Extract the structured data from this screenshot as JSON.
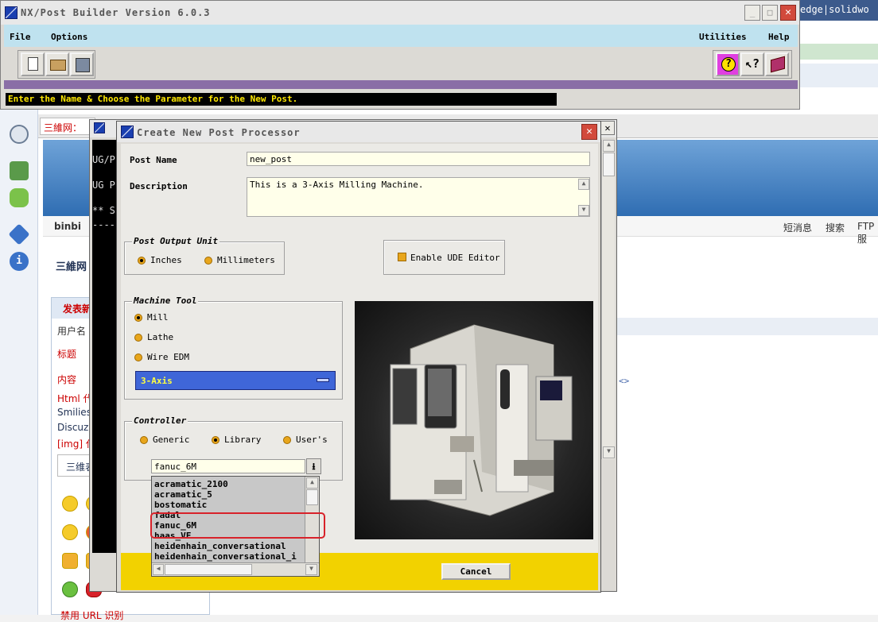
{
  "nx_window": {
    "title": "NX/Post Builder Version 6.0.3",
    "menus": {
      "file": "File",
      "options": "Options",
      "utilities": "Utilities",
      "help": "Help"
    },
    "toolbar": [
      "new-file-icon",
      "open-file-icon",
      "save-icon"
    ],
    "help_tools": [
      "help-question-icon",
      "context-help-icon",
      "manual-book-icon"
    ],
    "status_message": "Enter the Name & Choose the Parameter for the New Post."
  },
  "console": {
    "lines": [
      "UG/P",
      "UG P",
      "** S",
      "----"
    ]
  },
  "dialog": {
    "title": "Create New Post Processor",
    "post_name_label": "Post Name",
    "post_name_value": "new_post",
    "description_label": "Description",
    "description_value": "This is a 3-Axis Milling Machine.",
    "output_unit": {
      "title": "Post Output Unit",
      "options": [
        "Inches",
        "Millimeters"
      ],
      "selected": "Inches"
    },
    "ude_editor_label": "Enable UDE Editor",
    "machine_tool": {
      "title": "Machine Tool",
      "options": [
        "Mill",
        "Lathe",
        "Wire EDM"
      ],
      "selected": "Mill",
      "axis_value": "3-Axis"
    },
    "controller": {
      "title": "Controller",
      "options": [
        "Generic",
        "Library",
        "User's"
      ],
      "selected": "Library",
      "combo_value": "fanuc_6M",
      "list_items": [
        "acramatic_2100",
        "acramatic_5",
        "bostomatic",
        "fadal",
        "fanuc_6M",
        "haas_VF",
        "heidenhain_conversational",
        "heidenhain_conversational_i"
      ]
    },
    "cancel_label": "Cancel"
  },
  "background": {
    "right_tab": "edge|solidwo",
    "tab_label": "三維网：",
    "user_name": "binbi",
    "top_links": [
      "短消息",
      "搜索",
      "FTP服"
    ],
    "site_link": "三維网",
    "form_title": "发表新",
    "form_labels": [
      "用户名",
      "标题",
      "内容",
      "Html 代",
      "Smilies",
      "Discuz",
      "[img] 代"
    ],
    "emoticon_tab": "三维表情",
    "arrows": "<>",
    "check_label": "禁用 URL 识别"
  },
  "colors": {
    "menubar": "#bfe2ef",
    "status_text": "#ffe800",
    "radio": "#e8a61c",
    "select_blue": "#3f66d8",
    "footer_yellow": "#f2d200",
    "highlight_red": "#d8222a"
  }
}
